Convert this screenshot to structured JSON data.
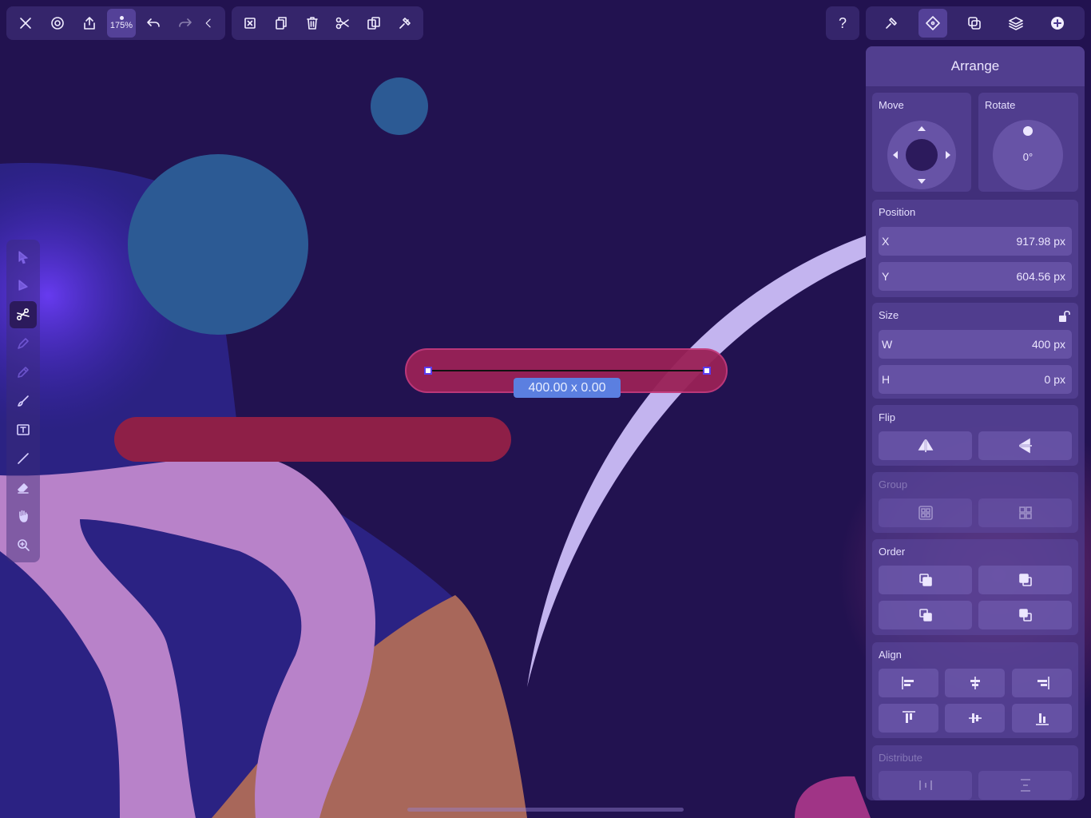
{
  "toolbar": {
    "zoom": "175%",
    "left_icons": [
      "close-icon",
      "settings-icon",
      "share-icon",
      "undo-icon",
      "redo-icon",
      "collapse-icon"
    ],
    "edit_icons": [
      "deselect-icon",
      "duplicate-icon",
      "delete-icon",
      "cut-icon",
      "copy-icon",
      "paste-style-icon"
    ],
    "help": "?",
    "right_icons": [
      "style-icon",
      "arrange-icon",
      "boolean-icon",
      "layers-icon",
      "add-icon"
    ]
  },
  "canvas": {
    "selection_size": "400.00 x 0.00"
  },
  "tools": [
    "select-icon",
    "direct-select-icon",
    "scissors-icon",
    "pen-icon",
    "pencil-icon",
    "brush-icon",
    "text-icon",
    "line-icon",
    "eraser-icon",
    "hand-icon",
    "zoom-icon"
  ],
  "panel": {
    "title": "Arrange",
    "move": {
      "label": "Move"
    },
    "rotate": {
      "label": "Rotate",
      "value": "0°"
    },
    "position": {
      "label": "Position",
      "x_label": "X",
      "x_value": "917.98 px",
      "y_label": "Y",
      "y_value": "604.56 px"
    },
    "size": {
      "label": "Size",
      "w_label": "W",
      "w_value": "400 px",
      "h_label": "H",
      "h_value": "0 px"
    },
    "flip": {
      "label": "Flip"
    },
    "group": {
      "label": "Group"
    },
    "order": {
      "label": "Order"
    },
    "align": {
      "label": "Align"
    },
    "distribute": {
      "label": "Distribute"
    }
  },
  "colors": {
    "background": "#221250",
    "accent_selection": "#5b7fe0",
    "red_bar": "#8e1f47",
    "blue_circle": "#2c5a94",
    "lavender": "#b882c9",
    "orange": "#a8675a"
  }
}
